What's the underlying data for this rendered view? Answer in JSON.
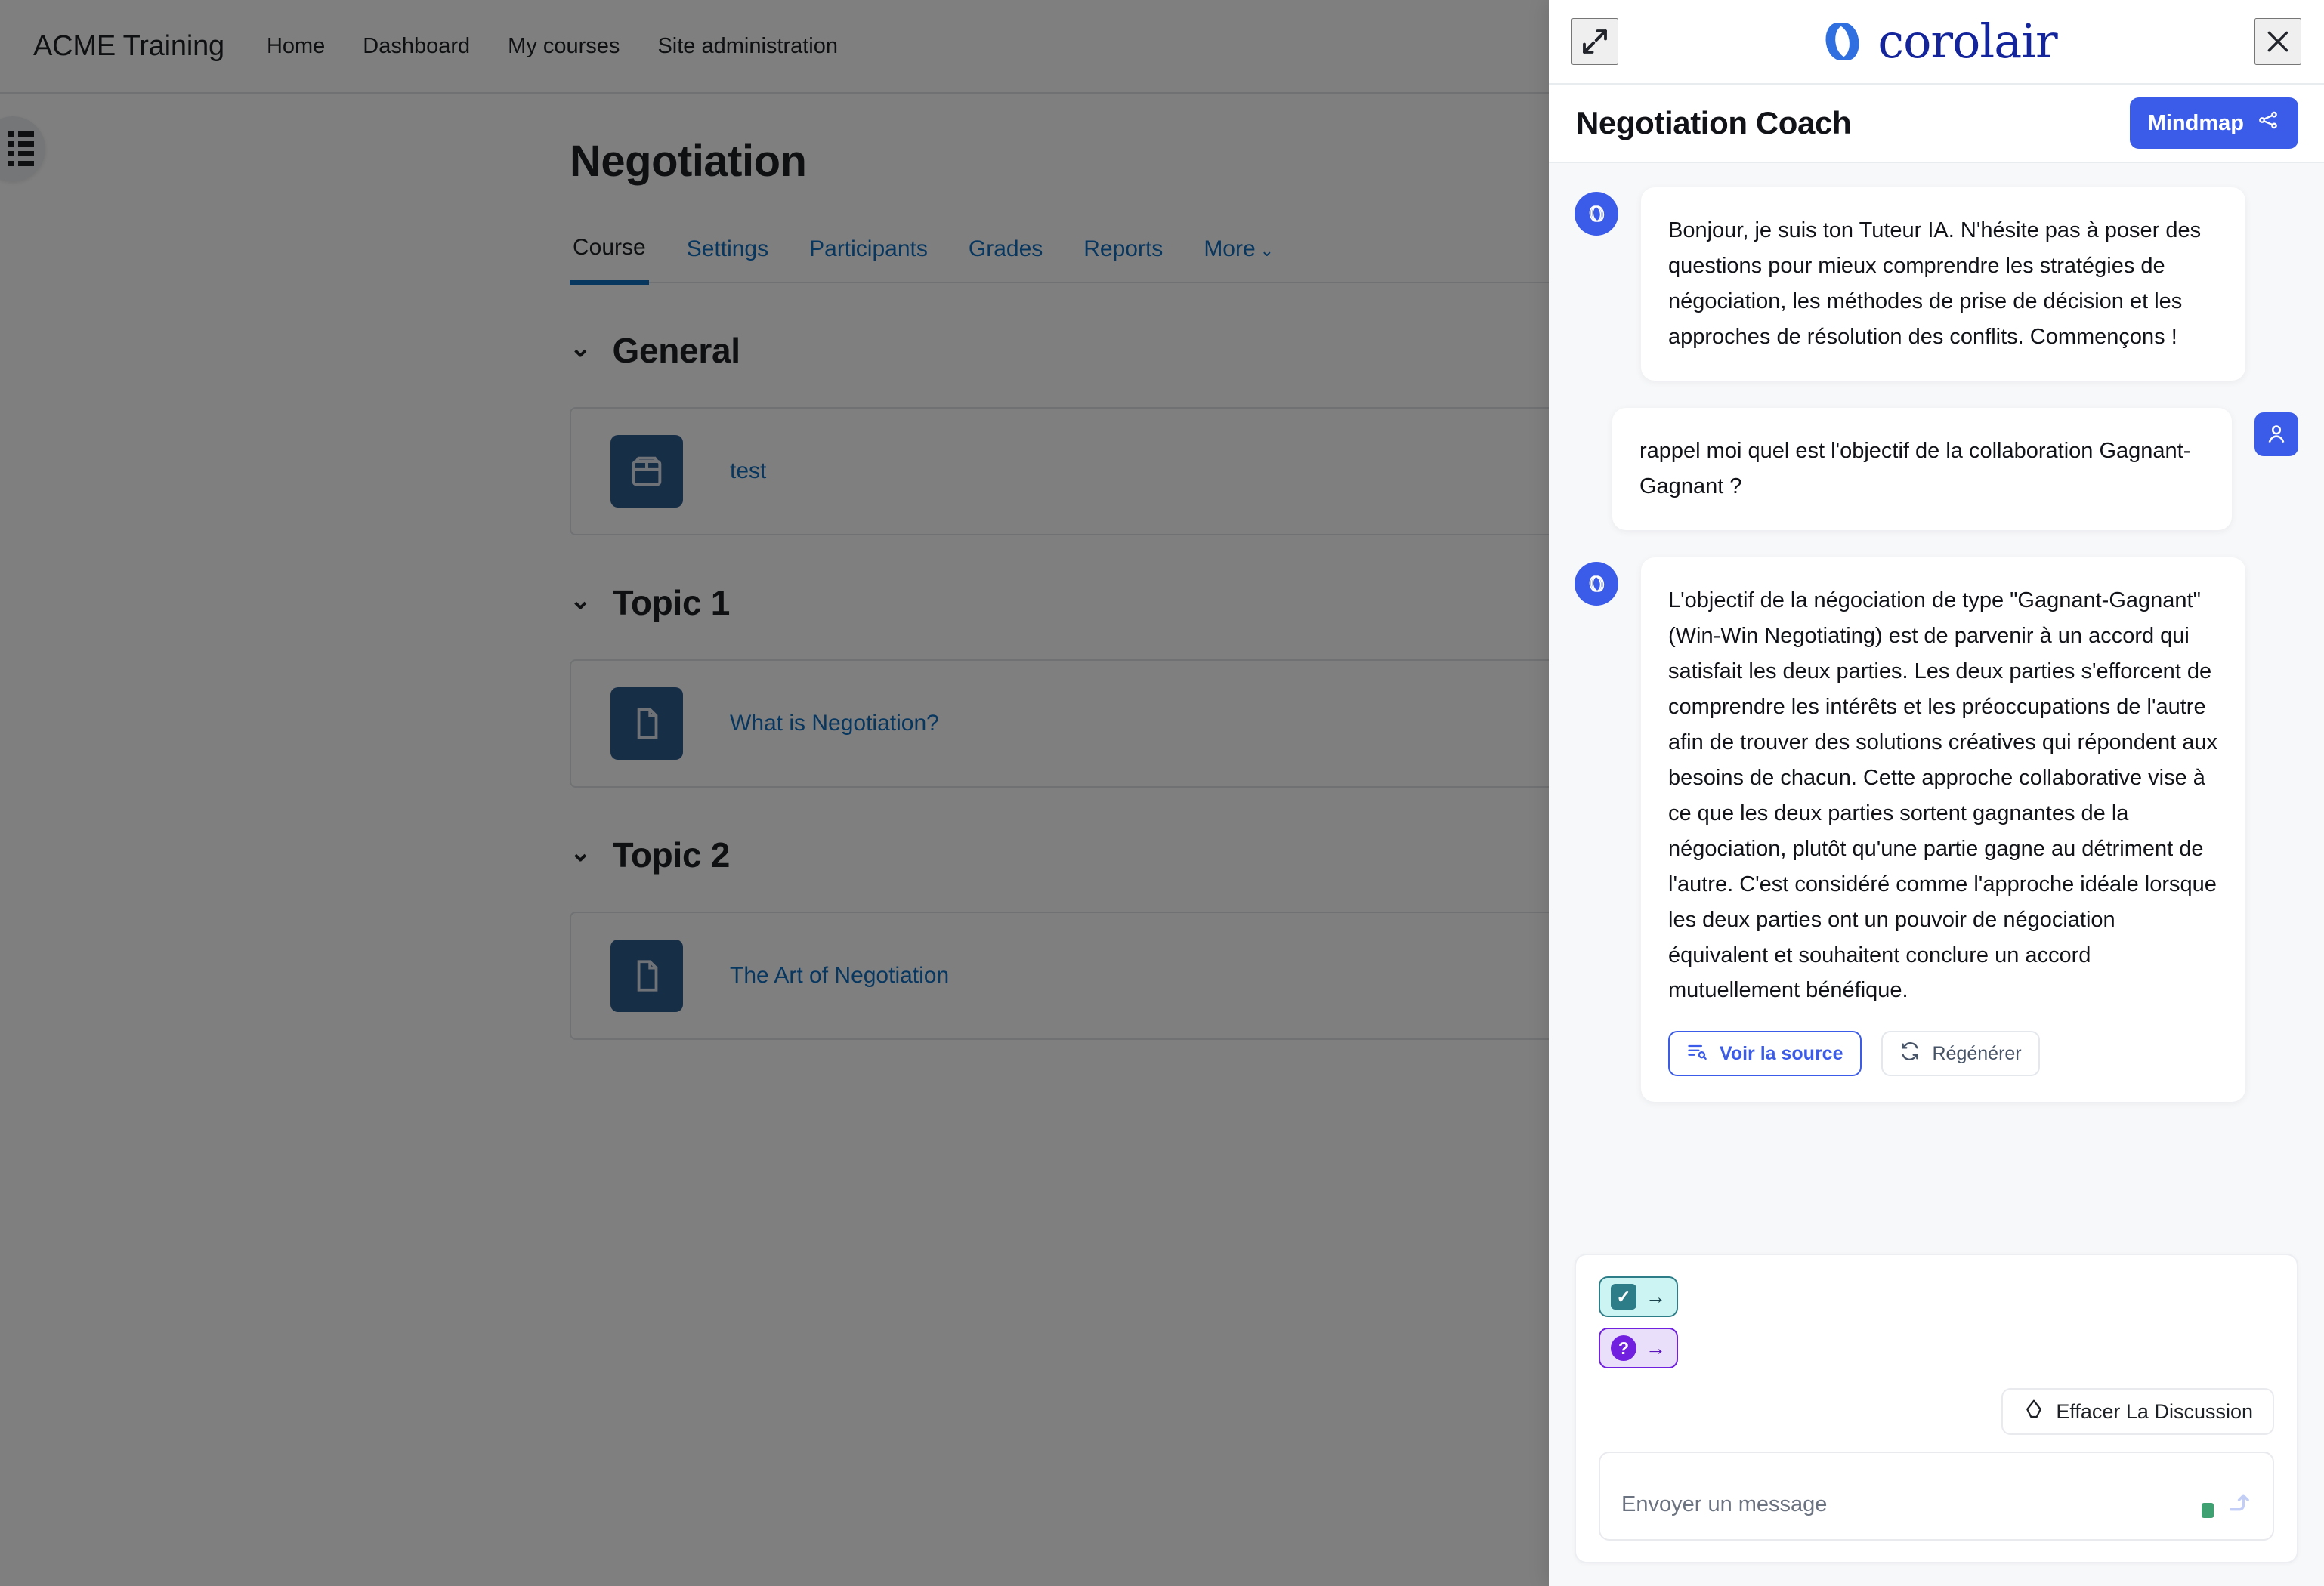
{
  "moodle": {
    "brand": "ACME Training",
    "nav": [
      {
        "label": "Home"
      },
      {
        "label": "Dashboard"
      },
      {
        "label": "My courses"
      },
      {
        "label": "Site administration"
      }
    ],
    "course_title": "Negotiation",
    "tabs": [
      {
        "label": "Course",
        "active": true
      },
      {
        "label": "Settings",
        "active": false
      },
      {
        "label": "Participants",
        "active": false
      },
      {
        "label": "Grades",
        "active": false
      },
      {
        "label": "Reports",
        "active": false
      },
      {
        "label": "More",
        "active": false,
        "chevron": "⌄"
      }
    ],
    "sections": [
      {
        "title": "General",
        "chevron": "⌄",
        "activity": {
          "name": "test",
          "icon": "package-icon"
        }
      },
      {
        "title": "Topic 1",
        "chevron": "⌄",
        "activity": {
          "name": "What is Negotiation?",
          "icon": "page-icon"
        }
      },
      {
        "title": "Topic 2",
        "chevron": "⌄",
        "activity": {
          "name": "The Art of Negotiation",
          "icon": "page-icon"
        }
      }
    ],
    "drawer_toggle": "course-index-toggle"
  },
  "panel": {
    "expand_icon": "expand-diagonal-icon",
    "close_icon": "close-icon",
    "logo_text": "corolair",
    "assistant_title": "Negotiation Coach",
    "mindmap_label": "Mindmap",
    "mindmap_icon": "mindmap-icon",
    "accent_blue": "#3b5ce8",
    "logo_navy": "#14259b",
    "messages": [
      {
        "role": "bot",
        "avatar_icon": "corolair-mark-icon",
        "text": "Bonjour, je suis ton Tuteur IA. N'hésite pas à poser des questions pour mieux comprendre les stratégies de négociation, les méthodes de prise de décision et les approches de résolution des conflits. Commençons !"
      },
      {
        "role": "user",
        "avatar_icon": "user-icon",
        "text": "rappel moi quel est l'objectif de la collaboration Gagnant-Gagnant ?"
      },
      {
        "role": "bot",
        "avatar_icon": "corolair-mark-icon",
        "text": "L'objectif de la négociation de type \"Gagnant-Gagnant\" (Win-Win Negotiating) est de parvenir à un accord qui satisfait les deux parties. Les deux parties s'efforcent de comprendre les intérêts et les préoccupations de l'autre afin de trouver des solutions créatives qui répondent aux besoins de chacun. Cette approche collaborative vise à ce que les deux parties sortent gagnantes de la négociation, plutôt qu'une partie gagne au détriment de l'autre. C'est considéré comme l'approche idéale lorsque les deux parties ont un pouvoir de négociation équivalent et souhaitent conclure un accord mutuellement bénéfique.",
        "actions": [
          {
            "label": "Voir la source",
            "icon": "source-list-icon",
            "style": "primary"
          },
          {
            "label": "Régénérer",
            "icon": "refresh-icon",
            "style": "ghost"
          }
        ]
      }
    ],
    "composer": {
      "chips": [
        {
          "name": "quiz-chip",
          "badge": "✓",
          "color": "teal",
          "arrow": "→"
        },
        {
          "name": "question-chip",
          "badge": "?",
          "color": "purple",
          "arrow": "→"
        }
      ],
      "clear_label": "Effacer La Discussion",
      "clear_icon": "eraser-icon",
      "input_placeholder": "Envoyer un message",
      "input_value": "",
      "send_icon": "send-arrow-icon"
    }
  }
}
